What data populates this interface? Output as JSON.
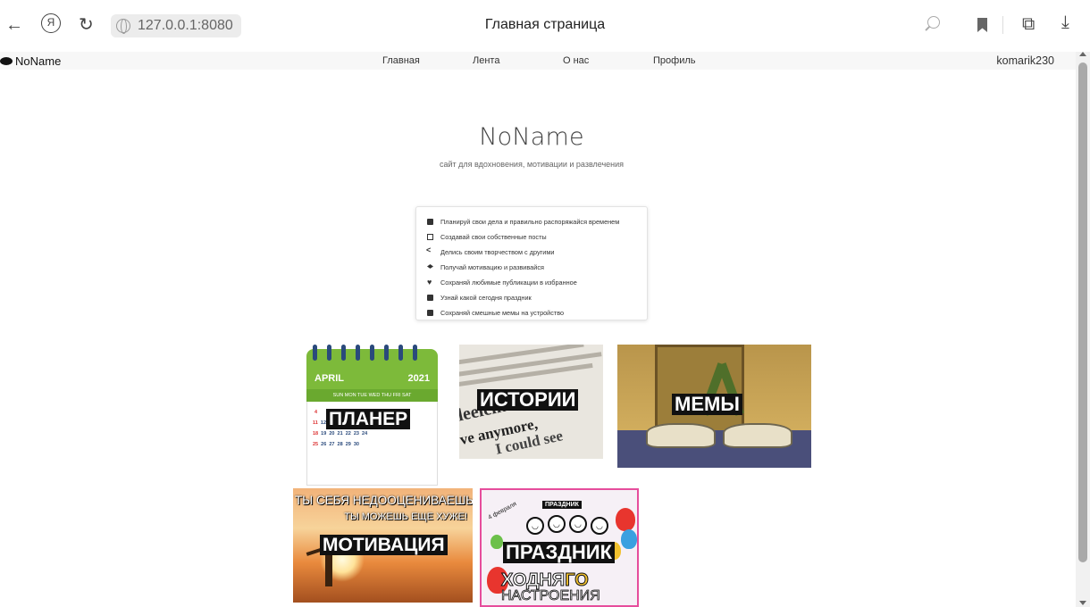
{
  "browser": {
    "url": "127.0.0.1:8080",
    "tab_title": "Главная страница"
  },
  "navbar": {
    "brand": "NoName",
    "links": [
      "Главная",
      "Лента",
      "О нас",
      "Профиль"
    ],
    "user": "komarik230"
  },
  "hero": {
    "title": "NoName",
    "subtitle": "сайт для вдохновения, мотивации и развлечения"
  },
  "features": [
    {
      "icon": "calendar-icon",
      "text": "Планируй свои дела и правильно распоряжайся временем"
    },
    {
      "icon": "edit-icon",
      "text": "Создавай свои собственные посты"
    },
    {
      "icon": "share-icon",
      "text": "Делись своим творчеством с другими"
    },
    {
      "icon": "graduation-cap-icon",
      "text": "Получай мотивацию и развивайся"
    },
    {
      "icon": "heart-icon",
      "text": "Сохраняй любимые публикации в избранное"
    },
    {
      "icon": "calendar-day-icon",
      "text": "Узнай какой сегодня праздник"
    },
    {
      "icon": "download-icon",
      "text": "Сохраняй смешные мемы на устройство"
    }
  ],
  "tiles": {
    "planner": {
      "label": "ПЛАНЕР",
      "month": "APRIL",
      "year": "2021",
      "weekdays": "SUN MON TUE WED THU FRI SAT"
    },
    "stories": {
      "label": "ИСТОРИИ"
    },
    "memes": {
      "label": "МЕМЫ"
    },
    "motivation": {
      "label": "МОТИВАЦИЯ",
      "caption_top": "ТЫ СЕБЯ НЕДООЦЕНИВАЕШЬ!",
      "caption_bottom": "ТЫ МОЖЕШЬ ЕЩЕ ХУЖЕ!"
    },
    "holiday": {
      "label": "ПРАЗДНИК",
      "banner": "ПРАЗДНИК",
      "date": "4 февраля",
      "line2": "ХОДНЯ",
      "line2b": "ГО",
      "line3": "НАСТРОЕНИЯ"
    }
  },
  "colors": {
    "planner_green": "#7dba3a",
    "holiday_border": "#e64d9c",
    "label_bg": "#111111"
  }
}
